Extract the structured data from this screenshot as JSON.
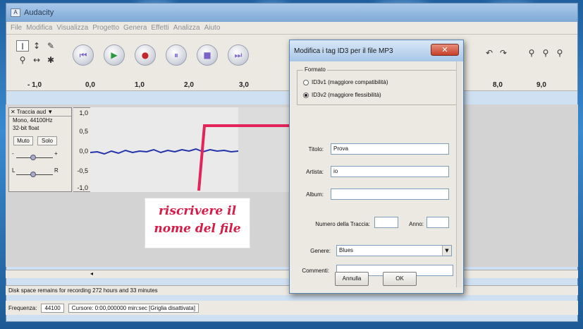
{
  "app": {
    "title": "Audacity",
    "menu": [
      "File",
      "Modifica",
      "Visualizza",
      "Progetto",
      "Genera",
      "Effetti",
      "Analizza",
      "Aiuto"
    ],
    "tools": {
      "select": "I",
      "envelope": "↕",
      "draw": "✎",
      "zoom": "⚲",
      "timeshift": "↔",
      "multi": "✱"
    },
    "transport": {
      "rewind": "⏮",
      "play": "▶",
      "record": "●",
      "pause": "⏸",
      "stop": "■",
      "forward": "⏭"
    },
    "ruler": [
      "- 1,0",
      "0,0",
      "1,0",
      "2,0",
      "3,0",
      "8,0",
      "9,0"
    ],
    "track": {
      "name": "Traccia aud",
      "info1": "Mono, 44100Hz",
      "info2": "32-bit float",
      "mute": "Muto",
      "solo": "Solo",
      "scale": [
        "1,0",
        "0,5",
        "0,0",
        "-0,5",
        "-1,0"
      ]
    },
    "status_disk": "Disk space remains for recording 272 hours and 33 minutes",
    "status_freq_label": "Frequenza:",
    "status_freq_value": "44100",
    "status_cursor": "Cursore: 0:00,000000 min:sec  [Griglia disattivata]"
  },
  "annotation": {
    "line1": "riscrivere il",
    "line2": "nome del file",
    "color": "#d81b46"
  },
  "dialog": {
    "title": "Modifica i tag ID3 per il file MP3",
    "close": "✕",
    "format_legend": "Formato",
    "option_v1": "ID3v1 (maggiore compatibilità)",
    "option_v2": "ID3v2 (maggiore flessibilità)",
    "fields": {
      "title_label": "Titolo:",
      "title_value": "Prova",
      "artist_label": "Artista:",
      "artist_value": "io",
      "album_label": "Album:",
      "album_value": "",
      "track_label": "Numero della Traccia:",
      "track_value": "",
      "year_label": "Anno:",
      "year_value": "",
      "genre_label": "Genere:",
      "genre_value": "Blues",
      "comment_label": "Commenti:",
      "comment_value": ""
    },
    "cancel": "Annulla",
    "ok": "OK"
  }
}
